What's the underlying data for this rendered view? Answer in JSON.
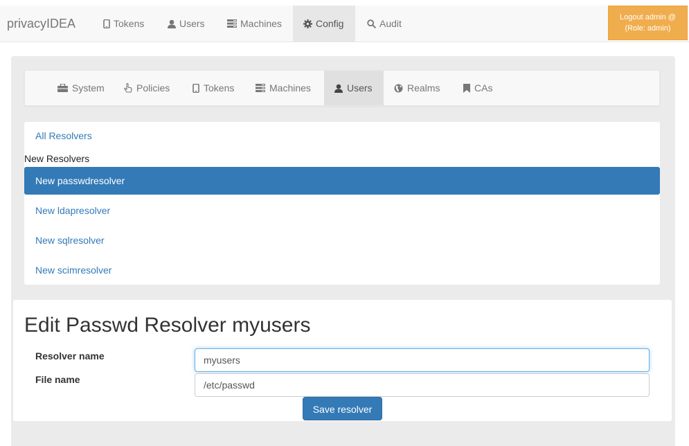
{
  "topnav": {
    "brand": "privacyIDEA",
    "items": [
      {
        "label": "Tokens",
        "icon": "phone-icon"
      },
      {
        "label": "Users",
        "icon": "user-icon"
      },
      {
        "label": "Machines",
        "icon": "tasks-icon"
      },
      {
        "label": "Config",
        "icon": "cog-icon",
        "active": true
      },
      {
        "label": "Audit",
        "icon": "search-icon"
      }
    ],
    "logout_line1": "Logout admin @",
    "logout_line2": "(Role: admin)"
  },
  "subnav": {
    "items": [
      {
        "label": "System",
        "icon": "briefcase-icon"
      },
      {
        "label": "Policies",
        "icon": "hand-icon"
      },
      {
        "label": "Tokens",
        "icon": "phone-icon"
      },
      {
        "label": "Machines",
        "icon": "tasks-icon"
      },
      {
        "label": "Users",
        "icon": "user-icon",
        "active": true
      },
      {
        "label": "Realms",
        "icon": "globe-icon"
      },
      {
        "label": "CAs",
        "icon": "bookmark-icon"
      }
    ]
  },
  "resolvers": {
    "all": "All Resolvers",
    "heading": "New Resolvers",
    "items": [
      "New passwdresolver",
      "New ldapresolver",
      "New sqlresolver",
      "New scimresolver"
    ]
  },
  "edit": {
    "title": "Edit Passwd Resolver myusers",
    "resolver_name_label": "Resolver name",
    "resolver_name_value": "myusers",
    "file_name_label": "File name",
    "file_name_value": "/etc/passwd",
    "save_label": "Save resolver"
  },
  "colors": {
    "primary": "#337ab7",
    "warning": "#f0ad4e",
    "navbar": "#f8f8f8",
    "panel": "#ebebeb"
  }
}
